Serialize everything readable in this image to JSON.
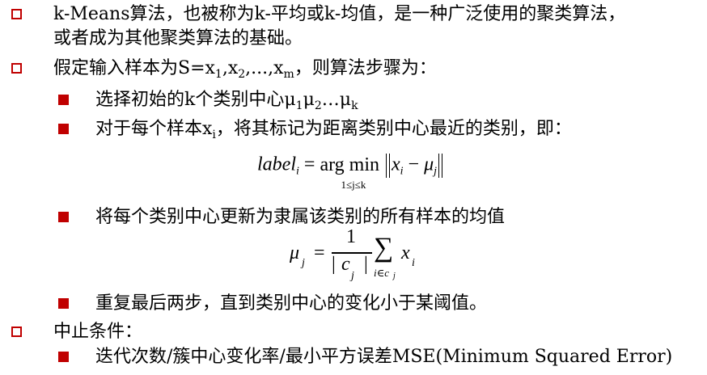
{
  "bullets": {
    "b1_line1": "k-Means算法，也被称为k-平均或k-均值，是一种广泛使用的聚类算法，",
    "b1_line2": "或者成为其他聚类算法的基础。",
    "b2_prefix": "假定输入样本为S=x",
    "b2_sub1": "1",
    "b2_mid1": ",x",
    "b2_sub2": "2",
    "b2_mid2": ",...,x",
    "b2_sub3": "m",
    "b2_suffix": "，则算法步骤为：",
    "s1_prefix": "选择初始的k个类别中心μ",
    "s1_sub1": "1",
    "s1_mid1": "μ",
    "s1_sub2": "2",
    "s1_mid2": "…μ",
    "s1_sub3": "k",
    "s2_prefix": "对于每个样本x",
    "s2_sub": "i",
    "s2_suffix": "，将其标记为距离类别中心最近的类别，即：",
    "s3": "将每个类别中心更新为隶属该类别的所有样本的均值",
    "s4": "重复最后两步，直到类别中心的变化小于某阈值。",
    "b3": "中止条件：",
    "s5": "迭代次数/簇中心变化率/最小平方误差MSE(Minimum Squared Error)"
  },
  "formula1": {
    "lhs": "label",
    "lhs_sub": "i",
    "eq": "=",
    "op": "arg min",
    "op_sub": "1≤j≤k",
    "x": "x",
    "x_sub": "i",
    "minus": "−",
    "mu": "μ",
    "mu_sub": "j"
  },
  "formula2": {
    "lhs": "μ",
    "lhs_sub": "j",
    "eq": "=",
    "num": "1",
    "den_bar1": "|",
    "den": "c",
    "den_sub": "j",
    "den_bar2": "|",
    "sum": "∑",
    "sum_sub": "i∈c",
    "sum_sub2": "j",
    "x": "x",
    "x_sub": "i"
  },
  "colors": {
    "bullet": "#c00000",
    "text": "#000000"
  }
}
